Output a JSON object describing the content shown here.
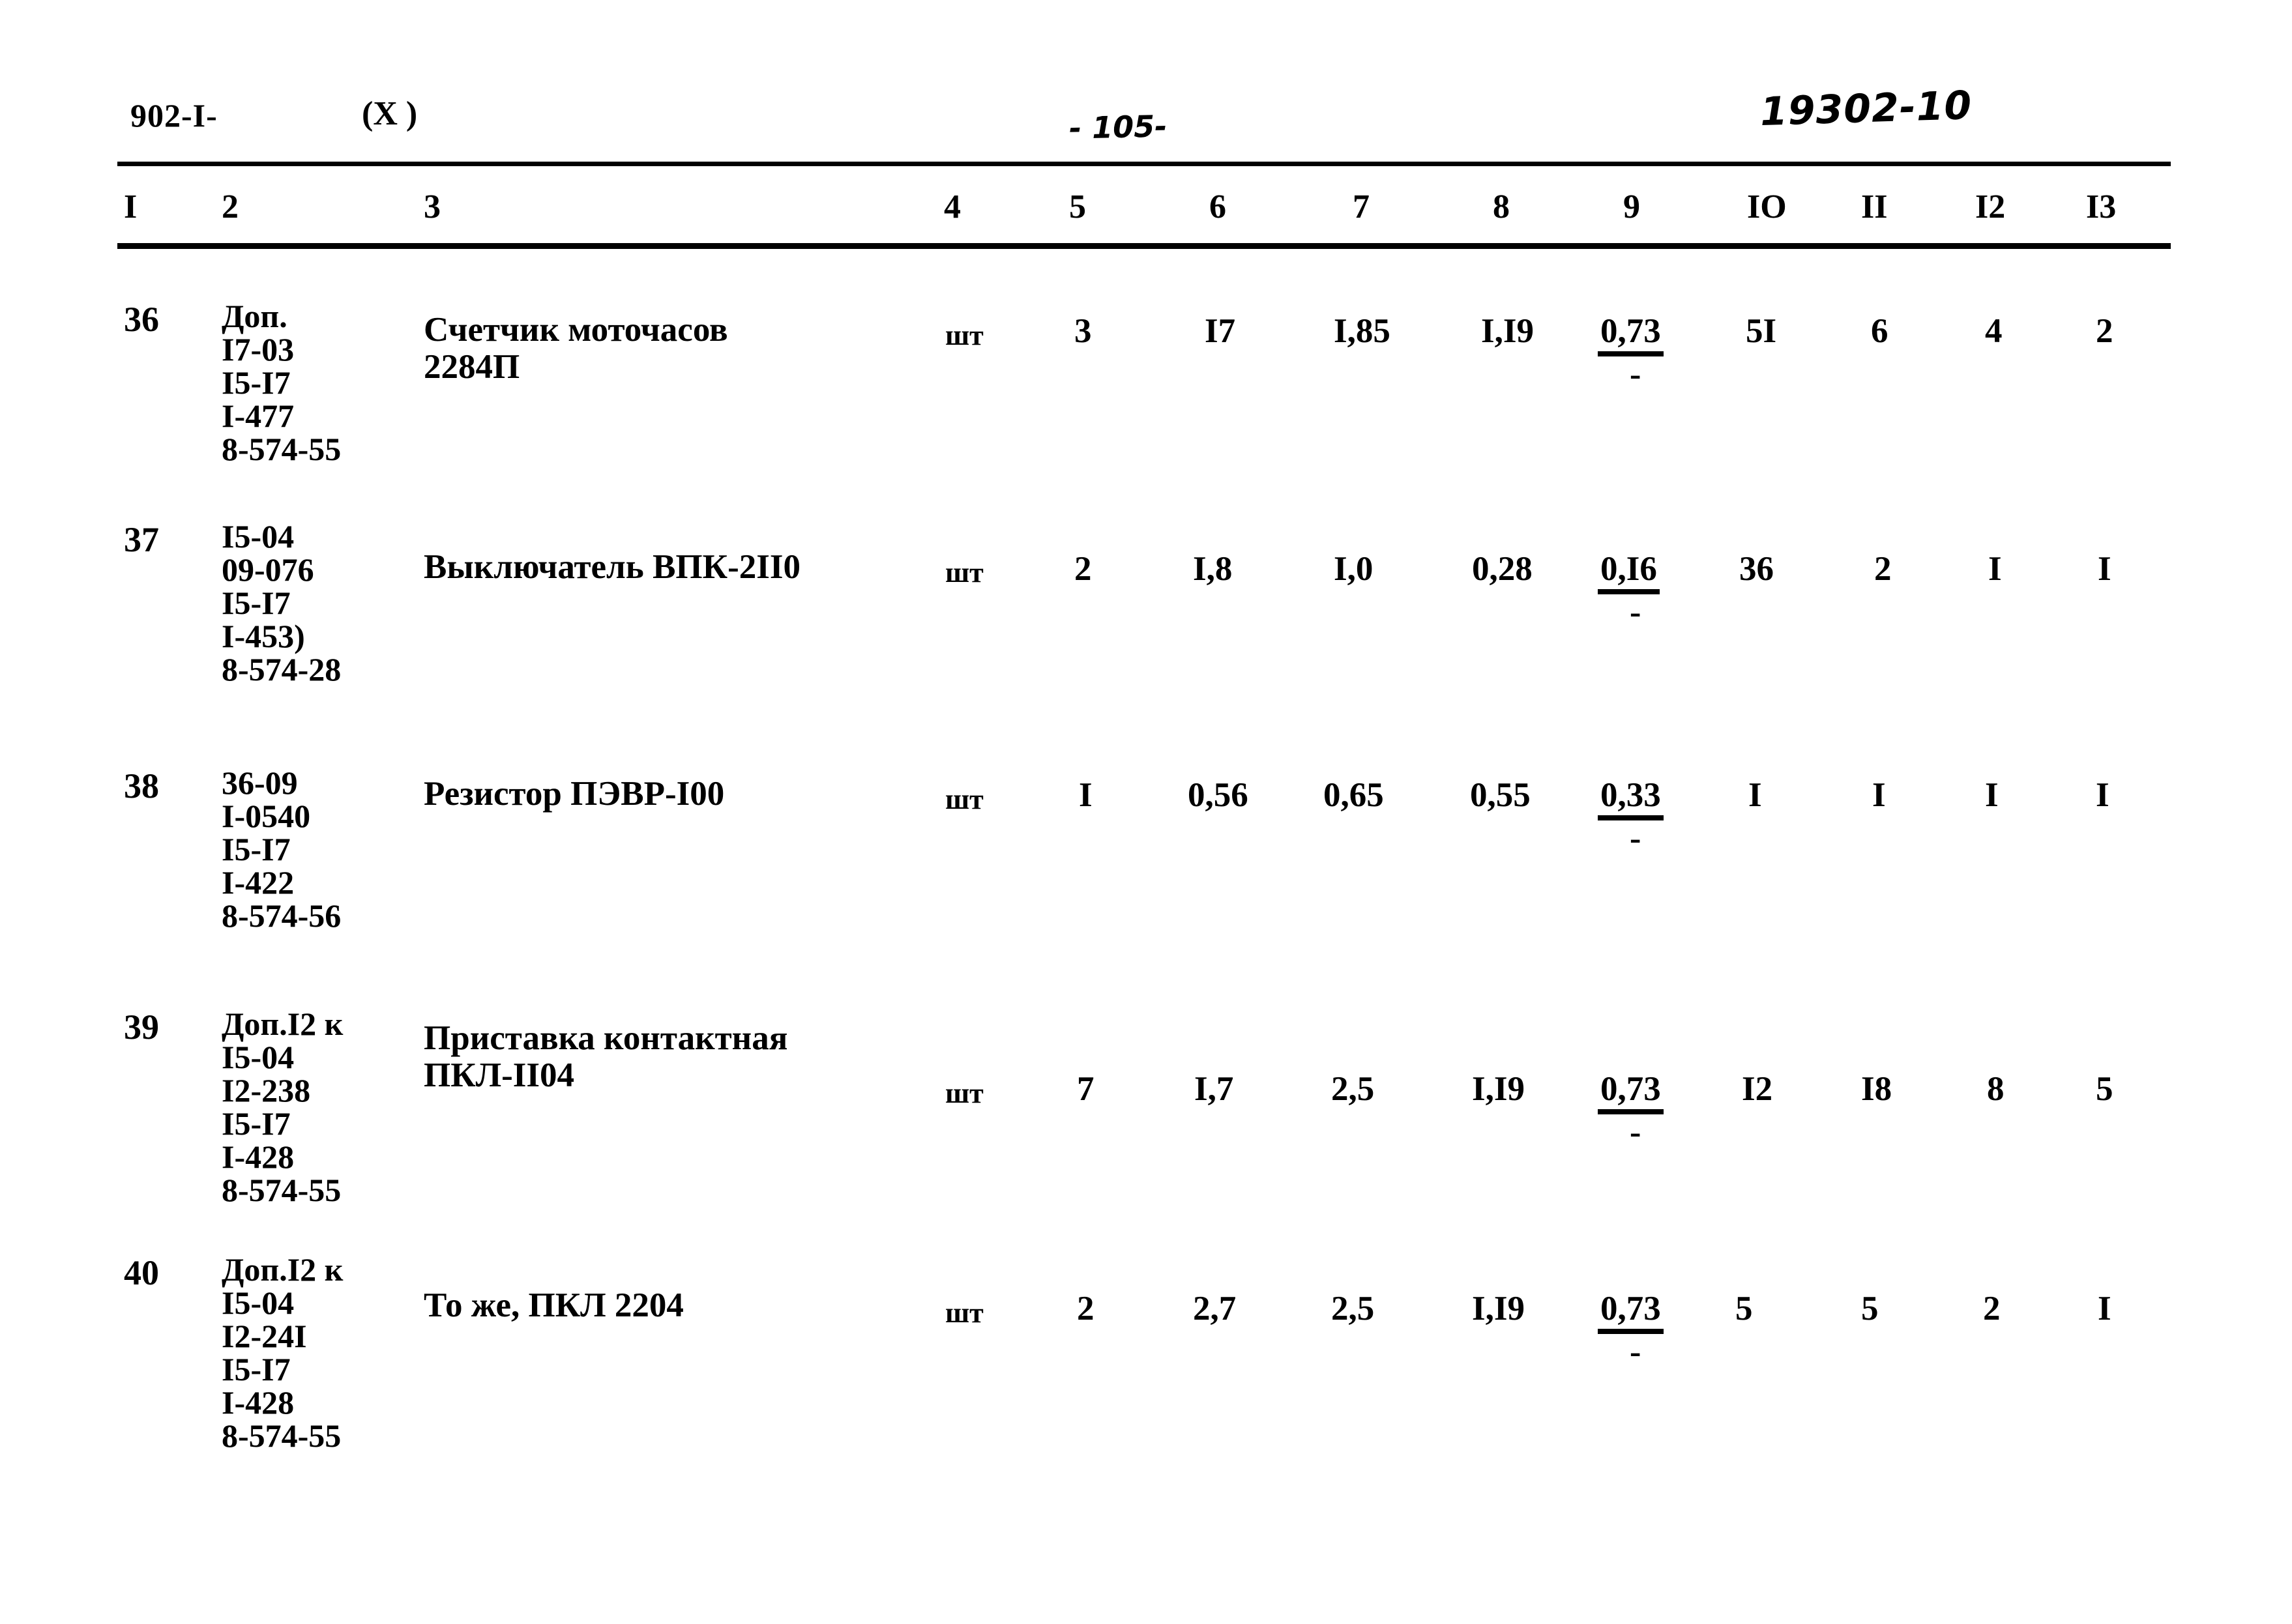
{
  "header": {
    "left_code": "902-I-",
    "variant": "(X )",
    "page_number": "- 105-",
    "doc_number": "19302-10"
  },
  "table": {
    "column_headers": [
      "I",
      "2",
      "3",
      "4",
      "5",
      "6",
      "7",
      "8",
      "9",
      "IO",
      "II",
      "I2",
      "I3"
    ],
    "rows": [
      {
        "num": "36",
        "codes": [
          "Доп.",
          "I7-03",
          "I5-I7",
          "I-477",
          "8-574-55"
        ],
        "description": [
          "Счетчик моточасов",
          "2284П"
        ],
        "unit": "шт",
        "c5": "3",
        "c6": "I7",
        "c7": "I,85",
        "c8": "I,I9",
        "c9": "0,73",
        "c9_sub": "-",
        "c10": "5I",
        "c11": "6",
        "c12": "4",
        "c13": "2"
      },
      {
        "num": "37",
        "codes": [
          "I5-04",
          "09-076",
          "I5-I7",
          "I-453)",
          "8-574-28"
        ],
        "description": [
          "Выключатель ВПК-2II0"
        ],
        "unit": "шт",
        "c5": "2",
        "c6": "I,8",
        "c7": "I,0",
        "c8": "0,28",
        "c9": "0,I6",
        "c9_sub": "-",
        "c10": "36",
        "c11": "2",
        "c12": "I",
        "c13": "I"
      },
      {
        "num": "38",
        "codes": [
          "36-09",
          "I-0540",
          "I5-I7",
          "I-422",
          "8-574-56"
        ],
        "description": [
          "Резистор ПЭВР-I00"
        ],
        "unit": "шт",
        "c5": "I",
        "c6": "0,56",
        "c7": "0,65",
        "c8": "0,55",
        "c9": "0,33",
        "c9_sub": "-",
        "c10": "I",
        "c11": "I",
        "c12": "I",
        "c13": "I"
      },
      {
        "num": "39",
        "codes": [
          "Доп.I2 к",
          "I5-04",
          "I2-238",
          "I5-I7",
          "I-428",
          "8-574-55"
        ],
        "description": [
          "Приставка контактная",
          "ПКЛ-II04"
        ],
        "unit": "шт",
        "c5": "7",
        "c6": "I,7",
        "c7": "2,5",
        "c8": "I,I9",
        "c9": "0,73",
        "c9_sub": "-",
        "c10": "I2",
        "c11": "I8",
        "c12": "8",
        "c13": "5"
      },
      {
        "num": "40",
        "codes": [
          "Доп.I2 к",
          "I5-04",
          "I2-24I",
          "I5-I7",
          "I-428",
          "8-574-55"
        ],
        "description": [
          "То же, ПКЛ 2204"
        ],
        "unit": "шт",
        "c5": "2",
        "c6": "2,7",
        "c7": "2,5",
        "c8": "I,I9",
        "c9": "0,73",
        "c9_sub": "-",
        "c10": "5",
        "c11": "5",
        "c12": "2",
        "c13": "I"
      }
    ]
  }
}
